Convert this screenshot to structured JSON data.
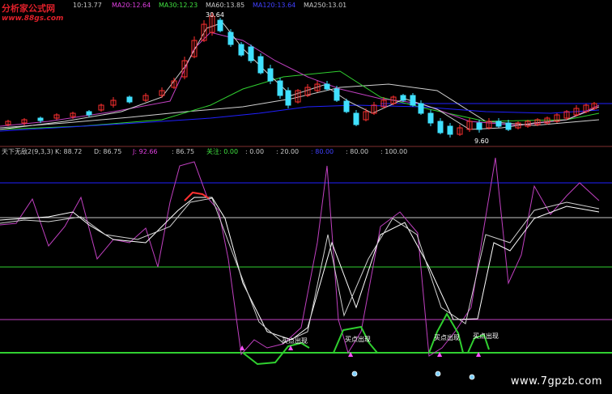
{
  "watermark_logo": {
    "main": "分析家公式网",
    "url": "www.88gs.com"
  },
  "watermark_site": "www.7gpzb.com",
  "main_panel": {
    "ma_items": [
      {
        "label": "10:13.77",
        "color": "#c8c8c8"
      },
      {
        "label": "MA20:12.64",
        "color": "#e040e0"
      },
      {
        "label": "MA30:12.23",
        "color": "#40e040"
      },
      {
        "label": "MA60:13.85",
        "color": "#c8c8c8"
      },
      {
        "label": "MA120:13.64",
        "color": "#4040ff"
      },
      {
        "label": "MA250:13.01",
        "color": "#c8c8c8"
      }
    ],
    "high_label": "30.64",
    "low_label": "9.60"
  },
  "indicator_panel": {
    "name": "天下无敌2(9,3,3)",
    "items": [
      {
        "label": "K: 88.72",
        "color": "#c8c8c8"
      },
      {
        "label": "D: 86.75",
        "color": "#c8c8c8"
      },
      {
        "label": "J: 92.66",
        "color": "#e040e0"
      },
      {
        "label": ": 86.75",
        "color": "#c8c8c8"
      },
      {
        "label": "关注: 0.00",
        "color": "#40e040"
      },
      {
        "label": ": 0.00",
        "color": "#c8c8c8"
      },
      {
        "label": ": 20.00",
        "color": "#c8c8c8"
      },
      {
        "label": ": 80.00",
        "color": "#4040ff"
      },
      {
        "label": ": 80.00",
        "color": "#c8c8c8"
      },
      {
        "label": ": 100.00",
        "color": "#c8c8c8"
      }
    ],
    "signals": [
      "买点出现",
      "买点出现",
      "买点出现",
      "买点出现"
    ]
  },
  "colors": {
    "up": "#ff3030",
    "down": "#40e0ff",
    "purple": "#c040c0",
    "green": "#30d030",
    "blue": "#2020ff",
    "grey": "#d0d0d0"
  }
}
